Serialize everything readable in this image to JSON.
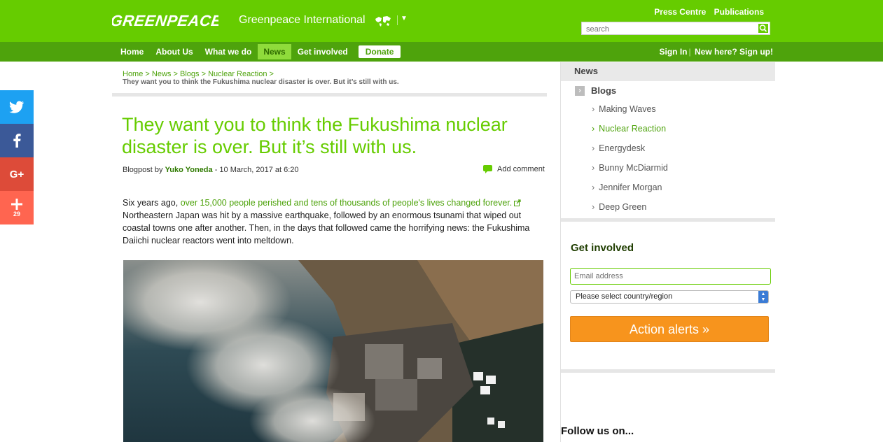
{
  "header": {
    "logo_text": "GREENPEACE",
    "site_title": "Greenpeace International",
    "press_centre": "Press Centre",
    "publications": "Publications",
    "search_placeholder": "search",
    "brand_color": "#66cc00",
    "nav_color": "#4ea30c"
  },
  "nav": {
    "items": [
      "Home",
      "About Us",
      "What we do",
      "News",
      "Get involved"
    ],
    "active": "News",
    "donate": "Donate",
    "sign_in": "Sign In",
    "new_here": "New here?",
    "sign_up": "Sign up!"
  },
  "social": {
    "twitter_icon": "twitter-icon",
    "facebook_icon": "facebook-icon",
    "googleplus_label": "G+",
    "share_icon": "plus-icon",
    "share_count": "29",
    "colors": {
      "twitter": "#1da1f2",
      "facebook": "#3b5998",
      "googleplus": "#dd4b39",
      "share": "#ff6550"
    }
  },
  "breadcrumb": {
    "items": [
      "Home",
      "News",
      "Blogs",
      "Nuclear Reaction"
    ],
    "separator": ">",
    "current": "They want you to think the Fukushima nuclear disaster is over. But it’s still with us."
  },
  "article": {
    "title": "They want you to think the Fukushima nuclear disaster is over. But it’s still with us.",
    "type": "Blogpost",
    "by": "by",
    "author": "Yuko Yoneda",
    "date": "- 10 March, 2017 at 6:20",
    "add_comment": "Add comment",
    "body_intro": "Six years ago,",
    "body_link": "over 15,000 people perished and tens of thousands of people's lives changed forever.",
    "body_rest": "Northeastern Japan was hit by a massive earthquake, followed by an enormous tsunami that wiped out coastal towns one after another. Then, in the days that followed came the horrifying news: the Fukushima Daiichi nuclear reactors went into meltdown."
  },
  "sidebar": {
    "news_title": "News",
    "blogs_label": "Blogs",
    "blogs": [
      "Making Waves",
      "Nuclear Reaction",
      "Energydesk",
      "Bunny McDiarmid",
      "Jennifer Morgan",
      "Deep Green"
    ],
    "active_blog": "Nuclear Reaction",
    "get_involved_title": "Get involved",
    "email_placeholder": "Email address",
    "country_select": "Please select country/region",
    "action_button": "Action alerts »",
    "action_color": "#f7941d",
    "follow_title": "Follow us on..."
  }
}
